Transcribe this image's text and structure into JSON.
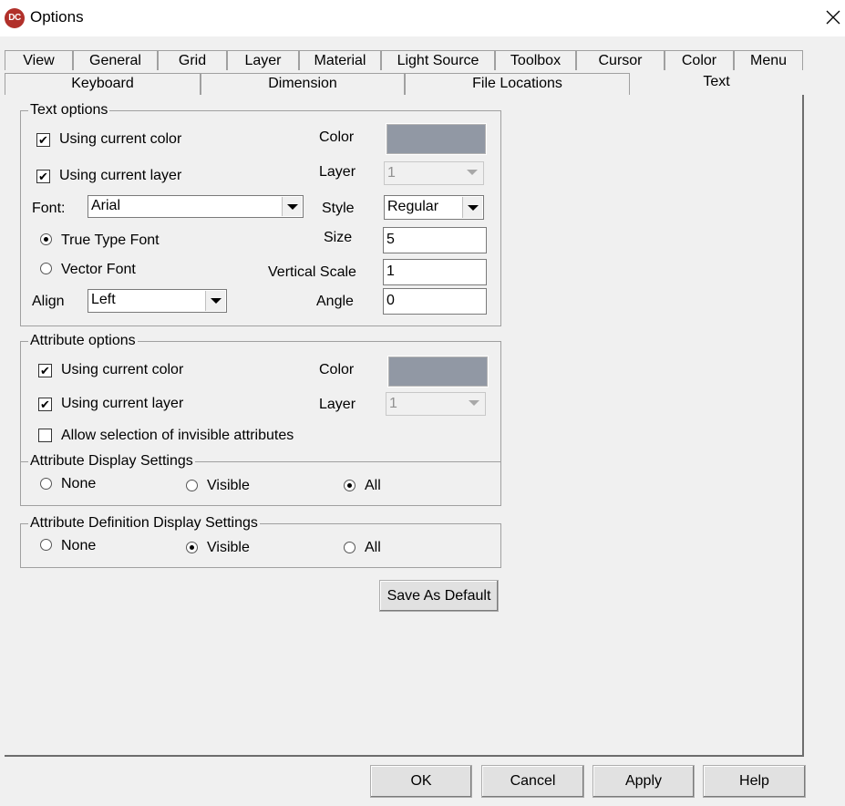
{
  "window": {
    "title": "Options",
    "icon_text": "DC"
  },
  "tabs_row1": [
    "View",
    "General",
    "Grid",
    "Layer",
    "Material",
    "Light Source",
    "Toolbox",
    "Cursor",
    "Color",
    "Menu"
  ],
  "tabs_row2": [
    "Keyboard",
    "Dimension",
    "File Locations",
    "Text"
  ],
  "active_tab": "Text",
  "text_options": {
    "legend": "Text options",
    "use_color_label": "Using current color",
    "use_color_checked": true,
    "use_layer_label": "Using current layer",
    "use_layer_checked": true,
    "color_label": "Color",
    "color_value": "#9198a4",
    "layer_label": "Layer",
    "layer_value": "1",
    "font_label": "Font:",
    "font_value": "Arial",
    "style_label": "Style",
    "style_value": "Regular",
    "truetype_label": "True Type Font",
    "vector_label": "Vector Font",
    "font_type_selected": "True Type Font",
    "size_label": "Size",
    "size_value": "5",
    "vscale_label": "Vertical Scale",
    "vscale_value": "1",
    "align_label": "Align",
    "align_value": "Left",
    "angle_label": "Angle",
    "angle_value": "0"
  },
  "attribute_options": {
    "legend": "Attribute options",
    "use_color_label": "Using current color",
    "use_color_checked": true,
    "use_layer_label": "Using current layer",
    "use_layer_checked": true,
    "color_label": "Color",
    "color_value": "#9198a4",
    "layer_label": "Layer",
    "layer_value": "1",
    "invisible_label": "Allow selection of invisible attributes",
    "invisible_checked": false,
    "display_legend": "Attribute Display Settings",
    "display_options": [
      "None",
      "Visible",
      "All"
    ],
    "display_selected": "All"
  },
  "attribute_definition": {
    "legend": "Attribute Definition Display Settings",
    "options": [
      "None",
      "Visible",
      "All"
    ],
    "selected": "Visible"
  },
  "buttons": {
    "save_default": "Save As Default",
    "ok": "OK",
    "cancel": "Cancel",
    "apply": "Apply",
    "help": "Help"
  }
}
